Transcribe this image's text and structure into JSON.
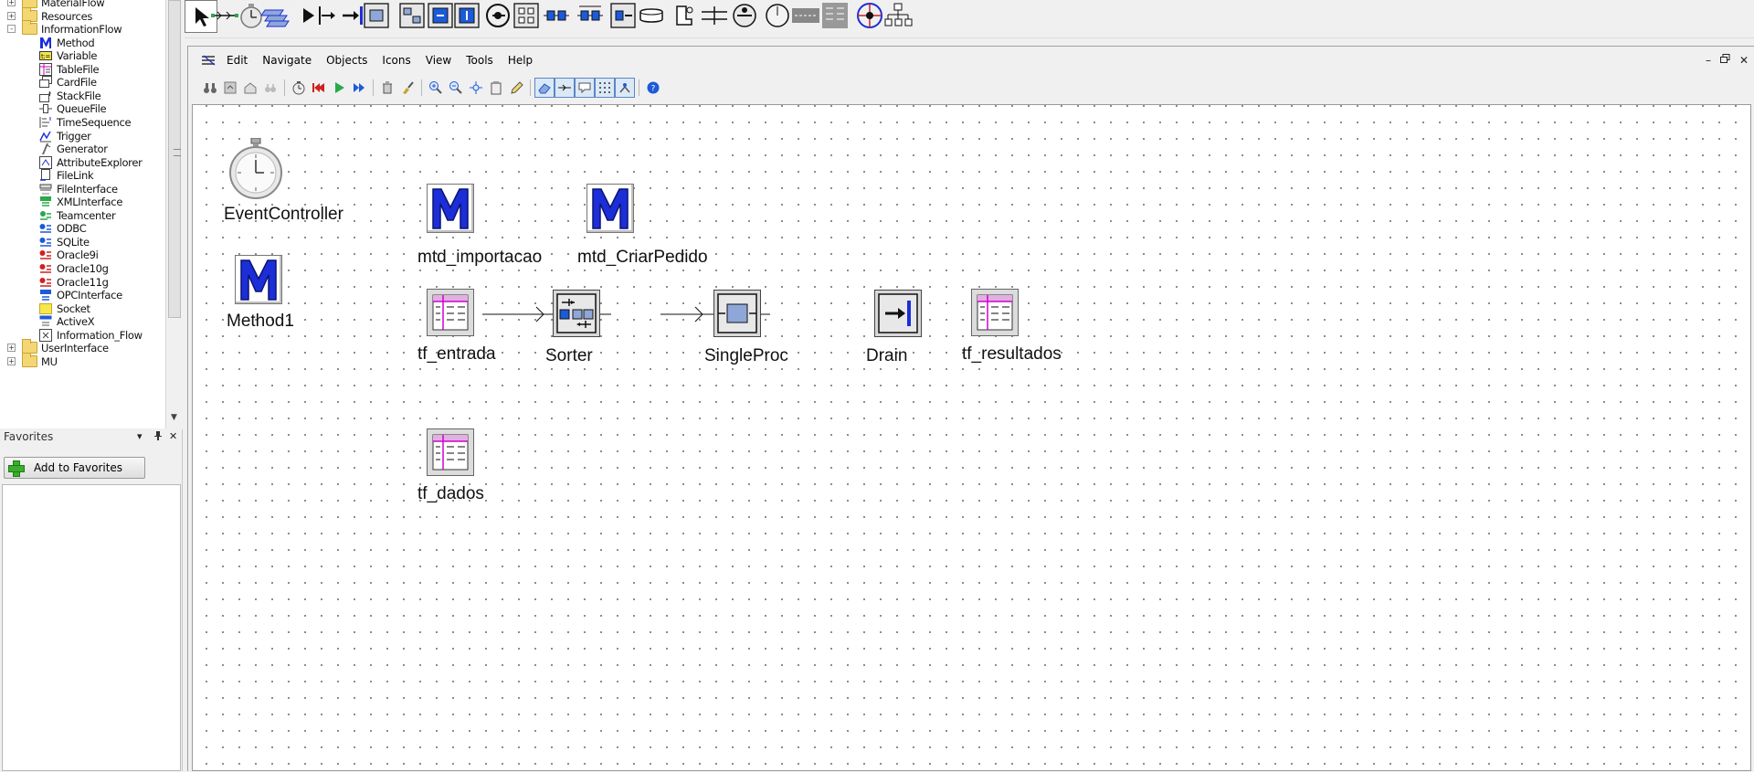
{
  "tree": {
    "items": [
      {
        "label": "MaterialFlow",
        "kind": "folder",
        "expanded": "+"
      },
      {
        "label": "Resources",
        "kind": "folder",
        "expanded": "+"
      },
      {
        "label": "InformationFlow",
        "kind": "folder",
        "expanded": "-"
      },
      {
        "label": "Method",
        "kind": "method"
      },
      {
        "label": "Variable",
        "kind": "variable"
      },
      {
        "label": "TableFile",
        "kind": "table"
      },
      {
        "label": "CardFile",
        "kind": "card"
      },
      {
        "label": "StackFile",
        "kind": "stack"
      },
      {
        "label": "QueueFile",
        "kind": "queue"
      },
      {
        "label": "TimeSequence",
        "kind": "timeseq"
      },
      {
        "label": "Trigger",
        "kind": "trigger"
      },
      {
        "label": "Generator",
        "kind": "generator"
      },
      {
        "label": "AttributeExplorer",
        "kind": "attrexp"
      },
      {
        "label": "FileLink",
        "kind": "filelink"
      },
      {
        "label": "FileInterface",
        "kind": "fileinterface"
      },
      {
        "label": "XMLInterface",
        "kind": "xml"
      },
      {
        "label": "Teamcenter",
        "kind": "teamcenter"
      },
      {
        "label": "ODBC",
        "kind": "db-blue"
      },
      {
        "label": "SQLite",
        "kind": "db-blue"
      },
      {
        "label": "Oracle9i",
        "kind": "db-red"
      },
      {
        "label": "Oracle10g",
        "kind": "db-red"
      },
      {
        "label": "Oracle11g",
        "kind": "db-red"
      },
      {
        "label": "OPCInterface",
        "kind": "opc"
      },
      {
        "label": "Socket",
        "kind": "socket"
      },
      {
        "label": "ActiveX",
        "kind": "activex"
      },
      {
        "label": "Information_Flow",
        "kind": "infoflow"
      },
      {
        "label": "UserInterface",
        "kind": "folder",
        "expanded": "+"
      },
      {
        "label": "MU",
        "kind": "folder",
        "expanded": "+"
      }
    ]
  },
  "favorites": {
    "title": "Favorites",
    "add_label": "Add to Favorites",
    "controls": [
      "▾",
      "ᵖ",
      "✕"
    ]
  },
  "toolbar": {
    "items": [
      "pointer-tool",
      "connector-tool",
      "event-controller-tool",
      "frame-tool",
      "source-tool",
      "singleproc-tool",
      "drain-tool",
      "parallelproc-tool",
      "assembly-tool",
      "dismantle-tool",
      "station-tool",
      "buffer-tool",
      "sorter-tool",
      "placebuffer-tool",
      "cycle-tool",
      "line-tool",
      "conveyor-tool",
      "track-tool",
      "turntable-tool",
      "turnplate-tool",
      "flow-tool",
      "store-tool",
      "exit-tool",
      "network-tool",
      "hierarchy-tool"
    ]
  },
  "menu": {
    "items": [
      "Edit",
      "Navigate",
      "Objects",
      "Icons",
      "View",
      "Tools",
      "Help"
    ],
    "window_controls": [
      "–",
      "🗗",
      "✕"
    ]
  },
  "canvas": {
    "objects": [
      {
        "id": "event-controller",
        "label": "EventController",
        "type": "clock"
      },
      {
        "id": "method1",
        "label": "Method1",
        "type": "method"
      },
      {
        "id": "mtd-importacao",
        "label": "mtd_importacao",
        "type": "method"
      },
      {
        "id": "mtd-criarpedido",
        "label": "mtd_CriarPedido",
        "type": "method"
      },
      {
        "id": "tf-entrada",
        "label": "tf_entrada",
        "type": "table"
      },
      {
        "id": "sorter",
        "label": "Sorter",
        "type": "sorter"
      },
      {
        "id": "singleproc",
        "label": "SingleProc",
        "type": "singleproc"
      },
      {
        "id": "drain",
        "label": "Drain",
        "type": "drain"
      },
      {
        "id": "tf-resultados",
        "label": "tf_resultados",
        "type": "table"
      },
      {
        "id": "tf-dados",
        "label": "tf_dados",
        "type": "table"
      }
    ]
  },
  "colors": {
    "method_blue": "#1c2ed8",
    "table_magenta": "#d000d0",
    "folder_yellow": "#f4d774",
    "grid_dot": "#707070"
  }
}
